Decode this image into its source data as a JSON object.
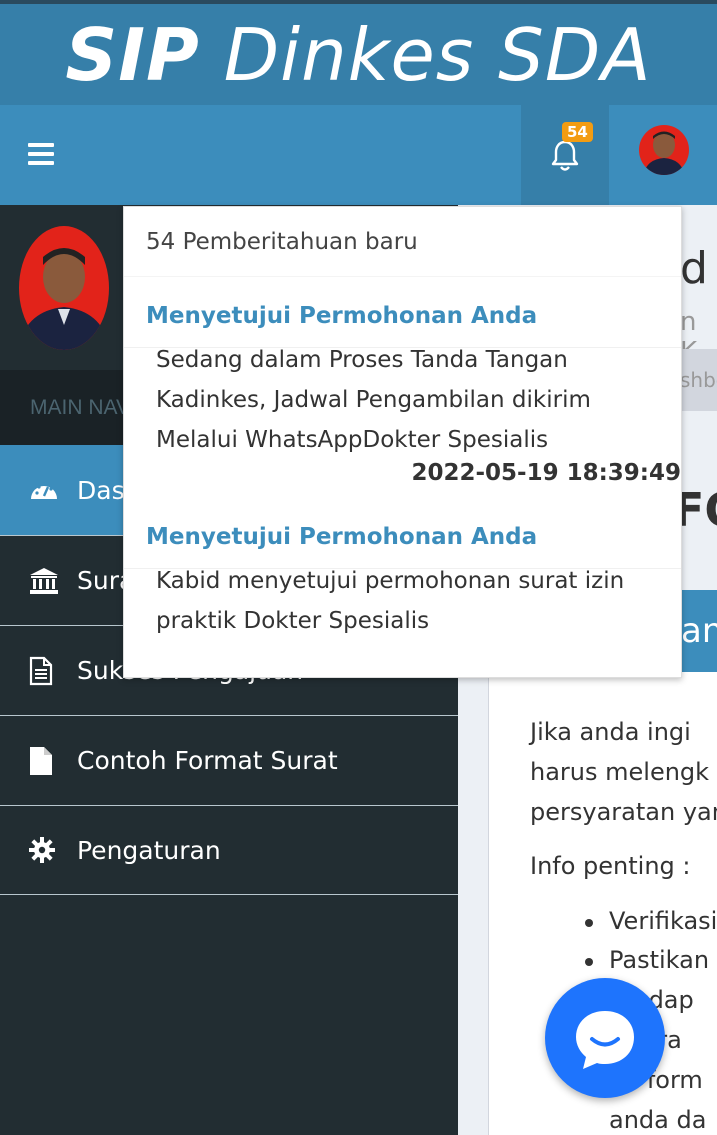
{
  "header": {
    "brand_bold": "SIP",
    "brand_rest": " Dinkes SDA",
    "notification_count": "54"
  },
  "sidebar": {
    "section_label": "MAIN NAVIGATION",
    "items": [
      {
        "label": "Dashboard",
        "icon": "dashboard-icon"
      },
      {
        "label": "Surat Izin",
        "icon": "bank-icon"
      },
      {
        "label": "Sukses Pengajuan",
        "icon": "file-text-icon"
      },
      {
        "label": "Contoh Format Surat",
        "icon": "file-icon"
      },
      {
        "label": "Pengaturan",
        "icon": "gear-icon"
      }
    ]
  },
  "dropdown": {
    "header": "54 Pemberitahuan baru",
    "notifications": [
      {
        "title": "Menyetujui Permohonan Anda",
        "body_lines": [
          "Sedang dalam Proses Tanda Tangan",
          "Kadinkes, Jadwal Pengambilan dikirim",
          "Melalui WhatsAppDokter Spesialis"
        ],
        "time": "2022-05-19 18:39:49"
      },
      {
        "title": "Menyetujui Permohonan Anda",
        "body_lines": [
          "Kabid menyetujui permohonan surat izin",
          "praktik Dokter Spesialis"
        ]
      }
    ]
  },
  "content": {
    "title_fragment": "d",
    "subtitle_fragment": "n K",
    "breadcrumb_fragment": "shbo",
    "big_fragment": "FO",
    "box_header_fragment": "an",
    "paragraph_lines": [
      "Jika anda ingi",
      "harus melengk",
      "persyaratan yan"
    ],
    "info_label": "Info penting :",
    "bullets": [
      "Verifikasi",
      "Pastikan"
    ],
    "trailing_lines": [
      "da dap",
      "m dra",
      "ka form",
      "anda da"
    ]
  },
  "colors": {
    "primary": "#3c8dbc",
    "primary_dark": "#367fa9",
    "sidebar": "#222d32",
    "badge": "#f39c12",
    "chat": "#1e74fd"
  }
}
